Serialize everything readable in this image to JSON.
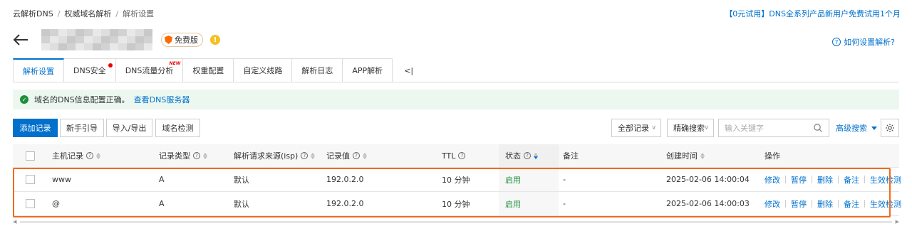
{
  "breadcrumb": [
    "云解析DNS",
    "权威域名解析",
    "解析设置"
  ],
  "promo": "【0元试用】DNS全系列产品新用户免费试用1个月",
  "header": {
    "badge": "免费版",
    "warn_glyph": "!"
  },
  "help_link": "如何设置解析?",
  "tabs": [
    {
      "label": "解析设置"
    },
    {
      "label": "DNS安全"
    },
    {
      "label": "DNS流量分析",
      "tag": "NEW"
    },
    {
      "label": "权重配置"
    },
    {
      "label": "自定义线路"
    },
    {
      "label": "解析日志"
    },
    {
      "label": "APP解析"
    }
  ],
  "tab_collapse": "<|",
  "notice": {
    "text": "域名的DNS信息配置正确。",
    "link": "查看DNS服务器"
  },
  "toolbar": {
    "add": "添加记录",
    "guide": "新手引导",
    "import_export": "导入/导出",
    "check": "域名检测",
    "filter": "全部记录",
    "search_mode": "精确搜索",
    "search_placeholder": "输入关键字",
    "advanced": "高级搜索"
  },
  "table": {
    "headers": {
      "host": "主机记录",
      "type": "记录类型",
      "isp": "解析请求来源(isp)",
      "value": "记录值",
      "ttl": "TTL",
      "status": "状态",
      "remark": "备注",
      "created": "创建时间",
      "ops": "操作"
    },
    "rows": [
      {
        "host": "www",
        "type": "A",
        "isp": "默认",
        "value": "192.0.2.0",
        "ttl": "10 分钟",
        "status": "启用",
        "remark": "-",
        "created": "2025-02-06 14:00:04"
      },
      {
        "host": "@",
        "type": "A",
        "isp": "默认",
        "value": "192.0.2.0",
        "ttl": "10 分钟",
        "status": "启用",
        "remark": "-",
        "created": "2025-02-06 14:00:03"
      }
    ],
    "actions": [
      "修改",
      "暂停",
      "删除",
      "备注",
      "生效检测"
    ]
  },
  "colors": {
    "accent": "#0070cc",
    "status_on": "#1e8e3e",
    "highlight": "#f26a1b",
    "notice_bg": "#ecf8ef"
  }
}
